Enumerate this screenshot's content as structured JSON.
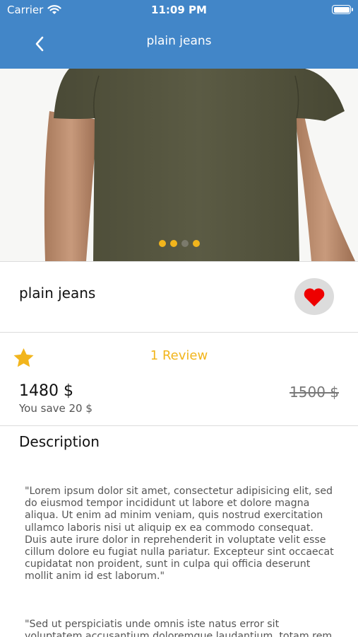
{
  "status_bar": {
    "carrier": "Carrier",
    "time": "11:09 PM"
  },
  "nav": {
    "title": "plain jeans",
    "back_icon": "chevron-left-icon"
  },
  "carousel": {
    "image": "olive green t-shirt product photo",
    "slide_count": 4,
    "active_index": 2
  },
  "product": {
    "name": "plain jeans",
    "favorite_icon": "heart-icon",
    "rating_icon": "star-icon",
    "review_label": "1 Review",
    "price": "1480 $",
    "savings": "You save 20 $",
    "original_price": "1500 $"
  },
  "description": {
    "title": "Description",
    "paragraphs": [
      "\"Lorem ipsum dolor sit amet, consectetur adipisicing elit, sed do eiusmod tempor incididunt ut labore et dolore magna aliqua. Ut enim ad minim veniam, quis nostrud exercitation ullamco laboris nisi ut aliquip ex ea commodo consequat. Duis aute irure dolor in reprehenderit in voluptate velit esse cillum dolore eu fugiat nulla pariatur. Excepteur sint occaecat cupidatat non proident, sunt in culpa qui officia deserunt mollit anim id est laborum.\"",
      "\"Sed ut perspiciatis unde omnis iste natus error sit voluptatem accusantium doloremque laudantium, totam rem"
    ]
  },
  "colors": {
    "header": "#4286c8",
    "accent": "#f2b51c",
    "heart": "#ee0000",
    "shirt": "#555540"
  }
}
